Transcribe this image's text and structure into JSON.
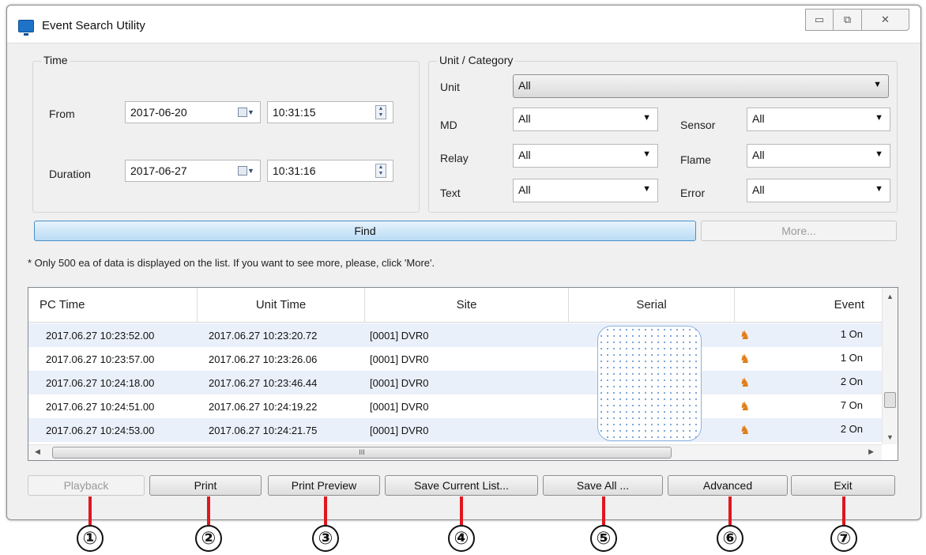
{
  "window": {
    "title": "Event Search Utility",
    "controls": [
      "minimize",
      "maximize",
      "close"
    ]
  },
  "time_group": {
    "legend": "Time",
    "from_label": "From",
    "from_date": "2017-06-20",
    "from_time": "10:31:15",
    "duration_label": "Duration",
    "duration_date": "2017-06-27",
    "duration_time": "10:31:16"
  },
  "unit_group": {
    "legend": "Unit / Category",
    "unit_label": "Unit",
    "unit_value": "All",
    "md_label": "MD",
    "md_value": "All",
    "sensor_label": "Sensor",
    "sensor_value": "All",
    "relay_label": "Relay",
    "relay_value": "All",
    "flame_label": "Flame",
    "flame_value": "All",
    "text_label": "Text",
    "text_value": "All",
    "error_label": "Error",
    "error_value": "All"
  },
  "actions": {
    "find": "Find",
    "more": "More..."
  },
  "note": "* Only 500 ea of data is displayed on the list. If you want to see more, please, click 'More'.",
  "table": {
    "columns": [
      "PC Time",
      "Unit Time",
      "Site",
      "Serial",
      "Event"
    ],
    "rows": [
      {
        "pc_time": "2017.06.27 10:23:52.00",
        "unit_time": "2017.06.27 10:23:20.72",
        "site": "[0001] DVR0",
        "serial": "",
        "event": "1 On"
      },
      {
        "pc_time": "2017.06.27 10:23:57.00",
        "unit_time": "2017.06.27 10:23:26.06",
        "site": "[0001] DVR0",
        "serial": "",
        "event": "1 On"
      },
      {
        "pc_time": "2017.06.27 10:24:18.00",
        "unit_time": "2017.06.27 10:23:46.44",
        "site": "[0001] DVR0",
        "serial": "",
        "event": "2 On"
      },
      {
        "pc_time": "2017.06.27 10:24:51.00",
        "unit_time": "2017.06.27 10:24:19.22",
        "site": "[0001] DVR0",
        "serial": "",
        "event": "7 On"
      },
      {
        "pc_time": "2017.06.27 10:24:53.00",
        "unit_time": "2017.06.27 10:24:21.75",
        "site": "[0001] DVR0",
        "serial": "",
        "event": "2 On"
      }
    ],
    "event_icon": "person-alarm-icon",
    "scroll_grip": "III"
  },
  "bottom_buttons": {
    "playback": "Playback",
    "print": "Print",
    "print_preview": "Print Preview",
    "save_current_list": "Save Current List...",
    "save_all": "Save All ...",
    "advanced": "Advanced",
    "exit": "Exit"
  },
  "callouts": [
    "①",
    "②",
    "③",
    "④",
    "⑤",
    "⑥",
    "⑦"
  ],
  "colors": {
    "callout_line": "#e0161e",
    "find_button": "#b9dcf5",
    "row_alt": "#eaf0fa"
  }
}
